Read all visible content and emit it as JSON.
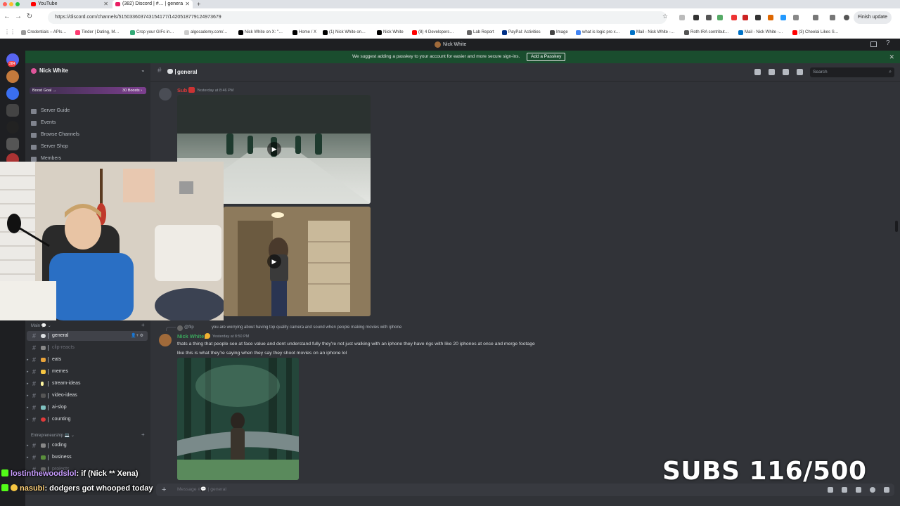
{
  "browser": {
    "tabs": [
      {
        "label": "YouTube"
      },
      {
        "label": "(382) Discord | #… | genera",
        "active": true
      }
    ],
    "url": "https://discord.com/channels/515033603743154177/1420518779124973679",
    "finish_update": "Finish update",
    "bookmarks": [
      "Credentials – APIs…",
      "Tinder | Dating, M…",
      "Crop your GIFs in…",
      "algocademy.com/…",
      "Nick White on X: \"…",
      "Home / X",
      "(1) Nick White on…",
      "Nick White",
      "(8) 4 Developers…",
      "Lab Report",
      "PayPal: Activities",
      "Image",
      "what is logic pro x…",
      "Mail - Nick White -…",
      "Roth IRA contribut…",
      "Mail - Nick White -…",
      "(3) Cheelai Likes S…"
    ]
  },
  "discord": {
    "window_title": "Nick White",
    "notice": {
      "text": "We suggest adding a passkey to your account for easier and more secure sign-ins.",
      "button": "Add a Passkey"
    },
    "rail_badge": "384",
    "server": {
      "name": "Nick White",
      "boost_label": "Boost Goal →",
      "boost_count": "30 Boosts ›",
      "nav": [
        "Server Guide",
        "Events",
        "Browse Channels",
        "Server Shop",
        "Members"
      ]
    },
    "categories": [
      {
        "label": "Main 💬 ⌄"
      },
      {
        "label": "Entrepreneurship 💻 ⌄"
      }
    ],
    "channels_main": [
      {
        "name": "general",
        "active": true
      },
      {
        "name": "clip-reacts"
      },
      {
        "name": "eats"
      },
      {
        "name": "memes"
      },
      {
        "name": "stream-ideas"
      },
      {
        "name": "video-ideas"
      },
      {
        "name": "ai-slop"
      },
      {
        "name": "counting"
      }
    ],
    "channels_ent": [
      {
        "name": "coding"
      },
      {
        "name": "business"
      },
      {
        "name": "projects"
      }
    ],
    "header": {
      "channel": "general",
      "search_placeholder": "Search",
      "search_icon": "⌕"
    },
    "messages": {
      "first": {
        "username": "Sub",
        "timestamp": "Yesterday at 8:46 PM"
      },
      "reply": {
        "reply_user": "@flip",
        "reply_text": "you are worrying about having top quality camera and sound when people making movies with iphone"
      },
      "second": {
        "username": "Nick White",
        "timestamp": "Yesterday at 8:50 PM",
        "line1": "thats a thing that people see at face value and dont understand fully they're not just walking with an iphone they have rigs with like 20 iphones at once and merge footage",
        "line2": "like this is what they're saying when they say they shoot movies on an iphone lol"
      }
    },
    "composer": {
      "placeholder": "Message #💬 | general",
      "plus": "+"
    }
  },
  "overlays": {
    "subs": "SUBS 116/500",
    "chat": [
      {
        "user": "lostinthewoodslol",
        "text": ": if (Nick ** Xena)"
      },
      {
        "user": "nasubi",
        "text": ": dodgers got whooped today"
      }
    ]
  },
  "colors": {
    "notice_bg": "#1a4d2e",
    "nick_name": "#3ba55c",
    "sub_name": "#e03a3a",
    "discord_bg": "#313338"
  }
}
